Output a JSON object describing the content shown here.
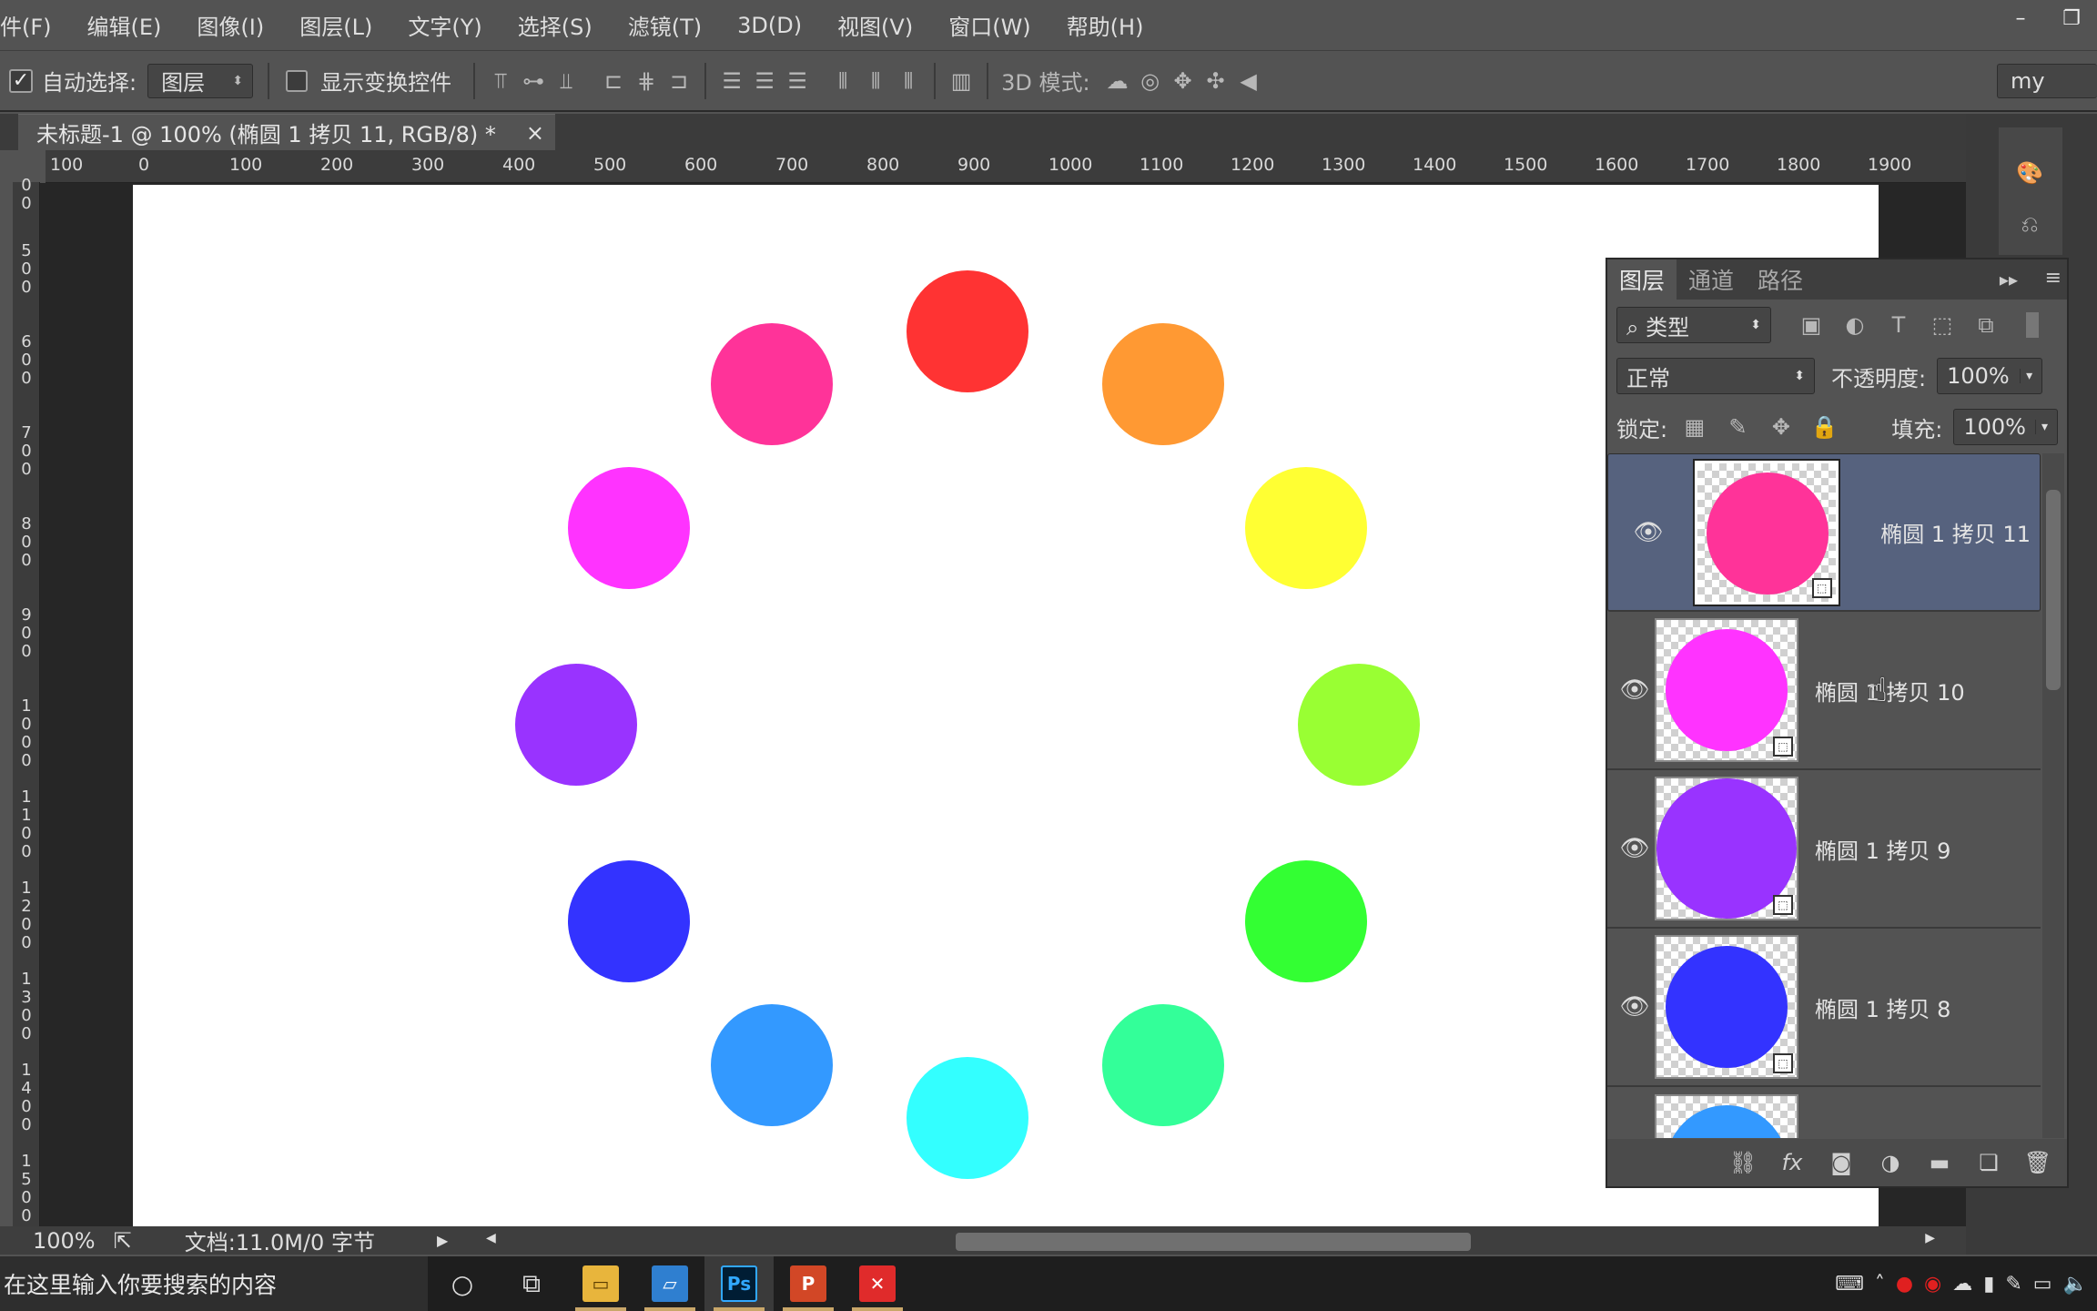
{
  "menu": [
    "件(F)",
    "编辑(E)",
    "图像(I)",
    "图层(L)",
    "文字(Y)",
    "选择(S)",
    "滤镜(T)",
    "3D(D)",
    "视图(V)",
    "窗口(W)",
    "帮助(H)"
  ],
  "options": {
    "auto_select_label": "自动选择:",
    "auto_select_value": "图层",
    "show_transform_label": "显示变换控件",
    "mode3d_label": "3D 模式:",
    "workspace": "my"
  },
  "document": {
    "tab_title": "未标题-1 @ 100% (椭圆 1 拷贝 11, RGB/8) *",
    "close": "×"
  },
  "ruler_h": [
    "100",
    "0",
    "100",
    "200",
    "300",
    "400",
    "500",
    "600",
    "700",
    "800",
    "900",
    "1000",
    "1100",
    "1200",
    "1300",
    "1400",
    "1500",
    "1600",
    "1700",
    "1800",
    "1900"
  ],
  "ruler_v": [
    "00",
    "500",
    "600",
    "700",
    "800",
    "900",
    "1000",
    "1100",
    "1200",
    "1300",
    "1400",
    "1500"
  ],
  "circles": [
    {
      "color": "#ff3333",
      "angle": 0
    },
    {
      "color": "#ff9933",
      "angle": 30
    },
    {
      "color": "#ffff33",
      "angle": 60
    },
    {
      "color": "#99ff33",
      "angle": 90
    },
    {
      "color": "#33ff33",
      "angle": 120
    },
    {
      "color": "#33ff99",
      "angle": 150
    },
    {
      "color": "#33ffff",
      "angle": 180
    },
    {
      "color": "#3399ff",
      "angle": 210
    },
    {
      "color": "#3333ff",
      "angle": 240
    },
    {
      "color": "#9933ff",
      "angle": 270
    },
    {
      "color": "#ff33ff",
      "angle": 300
    },
    {
      "color": "#ff3399",
      "angle": 330
    }
  ],
  "layers_panel": {
    "tabs": [
      "图层",
      "通道",
      "路径"
    ],
    "filter_label": "类型",
    "blend_mode": "正常",
    "opacity_label": "不透明度:",
    "opacity_value": "100%",
    "lock_label": "锁定:",
    "fill_label": "填充:",
    "fill_value": "100%",
    "layers": [
      {
        "name": "椭圆 1 拷贝 11",
        "color": "#ff3399",
        "selected": true
      },
      {
        "name": "椭圆 1 拷贝 10",
        "color": "#ff33ff",
        "selected": false
      },
      {
        "name": "椭圆 1 拷贝 9",
        "color": "#9933ff",
        "selected": false
      },
      {
        "name": "椭圆 1 拷贝 8",
        "color": "#3333ff",
        "selected": false
      },
      {
        "name": "",
        "color": "#3399ff",
        "selected": false
      }
    ]
  },
  "status": {
    "zoom": "100%",
    "doc_info": "文档:11.0M/0 字节"
  },
  "taskbar": {
    "search_placeholder": "在这里输入你要搜索的内容",
    "ps_label": "Ps",
    "ppt_label": "P",
    "layer_row_glyph": "椭"
  }
}
